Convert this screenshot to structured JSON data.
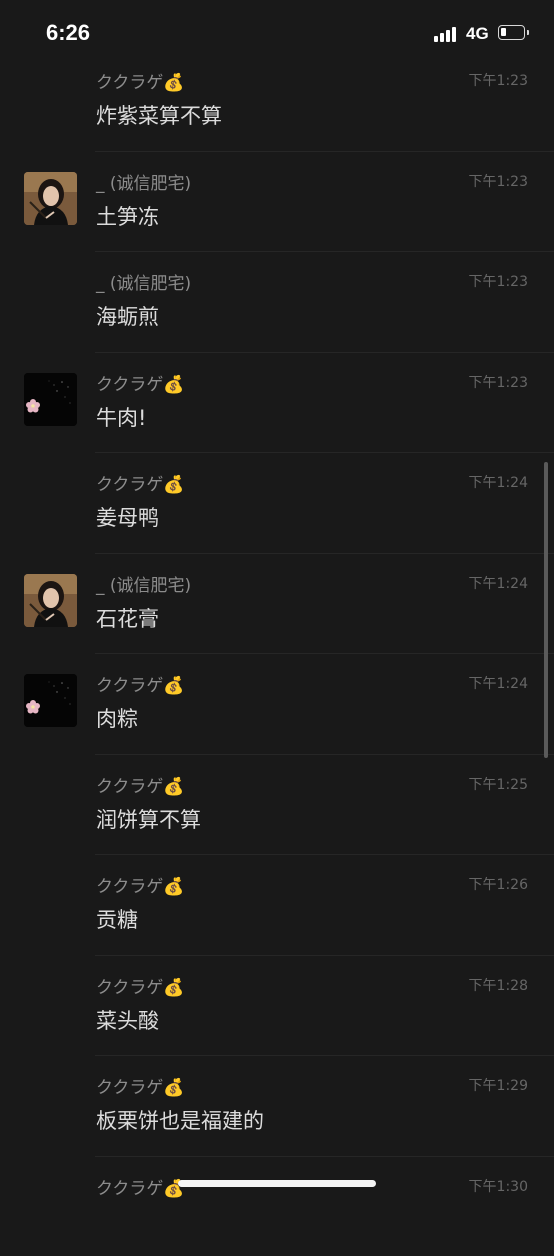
{
  "status_bar": {
    "time": "6:26",
    "network": "4G",
    "signal_level": 4,
    "battery_level": 0.15
  },
  "messages": [
    {
      "sender": "ククラゲ💰",
      "time": "下午1:23",
      "text": "炸紫菜算不算",
      "avatar": "none"
    },
    {
      "sender": "_ (诚信肥宅)",
      "time": "下午1:23",
      "text": "土笋冻",
      "avatar": "girl-avatar-icon"
    },
    {
      "sender": "_ (诚信肥宅)",
      "time": "下午1:23",
      "text": "海蛎煎",
      "avatar": "none"
    },
    {
      "sender": "ククラゲ💰",
      "time": "下午1:23",
      "text": "牛肉!",
      "avatar": "flower-avatar-icon"
    },
    {
      "sender": "ククラゲ💰",
      "time": "下午1:24",
      "text": "姜母鸭",
      "avatar": "none"
    },
    {
      "sender": "_ (诚信肥宅)",
      "time": "下午1:24",
      "text": "石花膏",
      "avatar": "girl-avatar-icon"
    },
    {
      "sender": "ククラゲ💰",
      "time": "下午1:24",
      "text": "肉粽",
      "avatar": "flower-avatar-icon"
    },
    {
      "sender": "ククラゲ💰",
      "time": "下午1:25",
      "text": "润饼算不算",
      "avatar": "none"
    },
    {
      "sender": "ククラゲ💰",
      "time": "下午1:26",
      "text": "贡糖",
      "avatar": "none"
    },
    {
      "sender": "ククラゲ💰",
      "time": "下午1:28",
      "text": "菜头酸",
      "avatar": "none"
    },
    {
      "sender": "ククラゲ💰",
      "time": "下午1:29",
      "text": "板栗饼也是福建的",
      "avatar": "none"
    },
    {
      "sender": "ククラゲ💰",
      "time": "下午1:30",
      "text": "",
      "avatar": "none"
    }
  ],
  "colors": {
    "background": "#191919",
    "name": "#8c8c8c",
    "message_text": "#dcdcdc",
    "timestamp": "#666666"
  }
}
